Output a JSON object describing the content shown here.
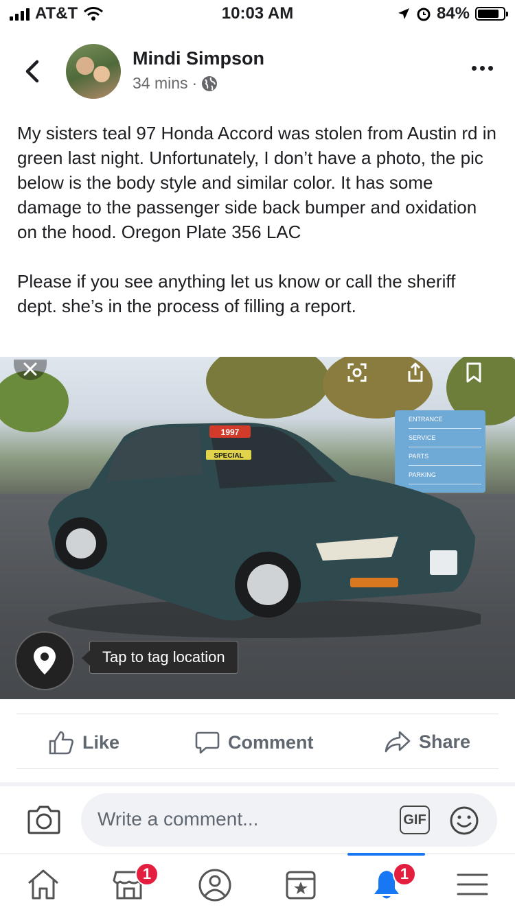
{
  "status_bar": {
    "carrier": "AT&T",
    "time": "10:03 AM",
    "battery": "84%",
    "battery_level": 0.84
  },
  "post": {
    "author": "Mindi Simpson",
    "time_ago": "34 mins",
    "separator": "·",
    "privacy_icon": "globe-icon",
    "text": "My sisters teal 97 Honda Accord was stolen from Austin rd in green last night. Unfortunately, I don’t have a photo, the pic below is the body style and similar color. It has some damage to the passenger side back bumper and oxidation on the hood. Oregon Plate 356 LAC\n\nPlease if you see anything let us know or call the sheriff dept. she’s in the process of filling a report.",
    "photo": {
      "windshield_sticker_year": "1997",
      "windshield_sticker": "SPECIAL",
      "sign_lines": [
        "ENTRANCE",
        "SERVICE",
        "PARTS",
        "PARKING"
      ],
      "tag_location_label": "Tap to tag location"
    }
  },
  "actions": {
    "like": "Like",
    "comment": "Comment",
    "share": "Share"
  },
  "composer": {
    "placeholder": "Write a comment...",
    "gif_label": "GIF"
  },
  "tabbar": {
    "items": [
      {
        "name": "home",
        "icon": "home-icon"
      },
      {
        "name": "marketplace",
        "icon": "marketplace-icon",
        "badge": "1"
      },
      {
        "name": "profile",
        "icon": "profile-icon"
      },
      {
        "name": "pages",
        "icon": "pages-icon"
      },
      {
        "name": "notifications",
        "icon": "bell-icon",
        "badge": "1",
        "active": true
      },
      {
        "name": "menu",
        "icon": "menu-icon"
      }
    ]
  },
  "colors": {
    "accent": "#1877f2",
    "badge": "#e41e3f",
    "secondary_text": "#65676b"
  }
}
